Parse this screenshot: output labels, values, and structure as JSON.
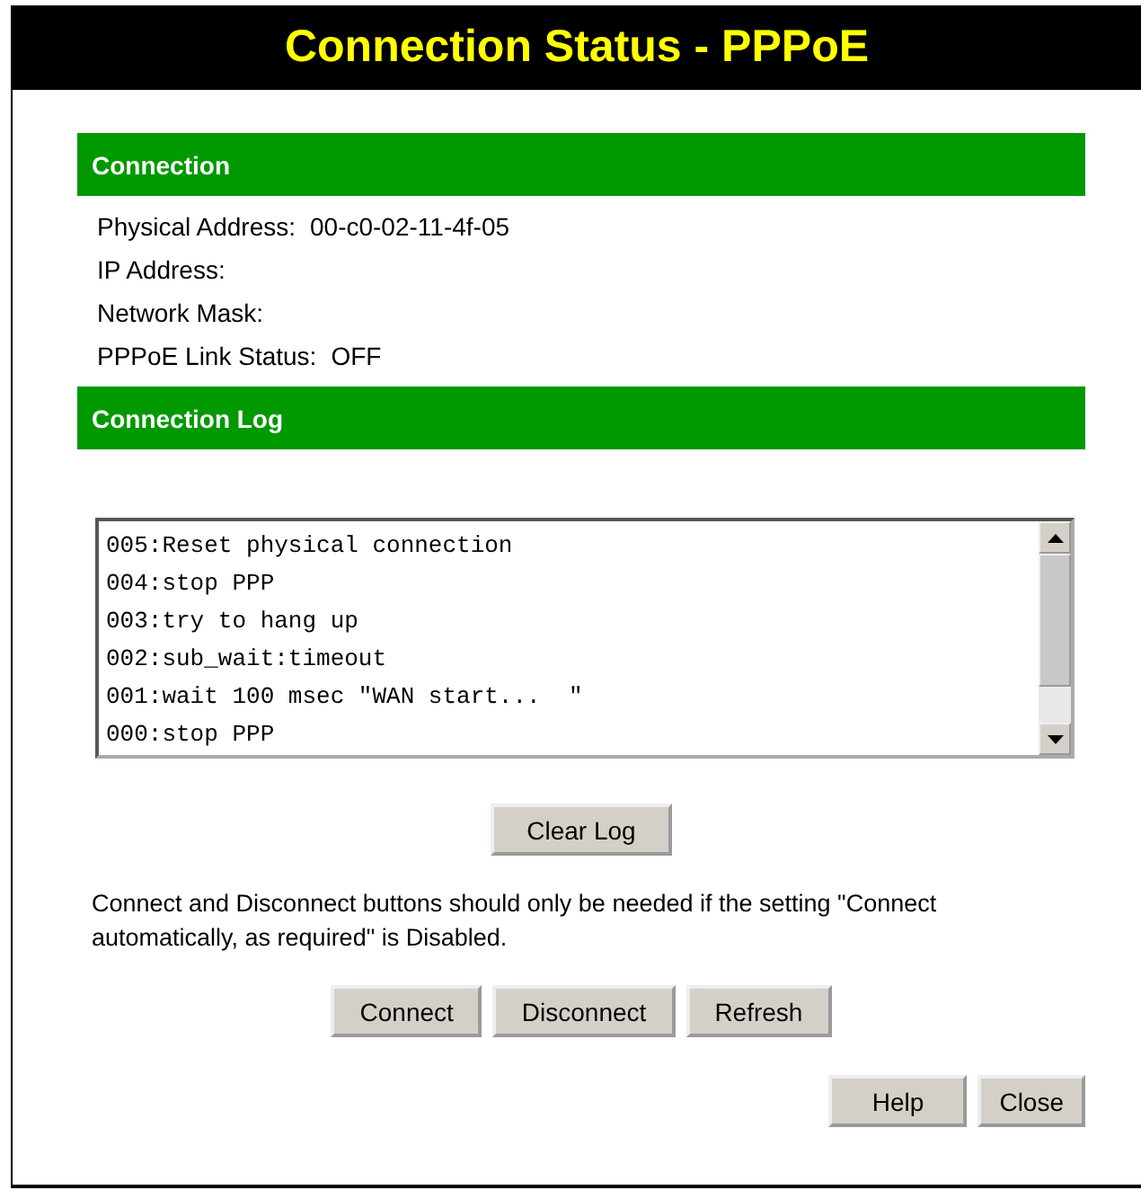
{
  "title": "Connection Status - PPPoE",
  "connection": {
    "heading": "Connection",
    "fields": [
      {
        "label": "Physical Address:",
        "value": "00-c0-02-11-4f-05"
      },
      {
        "label": "IP Address:"
      },
      {
        "label": "Network Mask:"
      },
      {
        "label": "PPPoE Link Status:",
        "value": "OFF"
      }
    ]
  },
  "log": {
    "heading": "Connection Log",
    "lines": [
      "005:Reset physical connection",
      "004:stop PPP",
      "003:try to hang up",
      "002:sub_wait:timeout",
      "001:wait 100 msec \"WAN start...  \"",
      "000:stop PPP"
    ],
    "clear_button": "Clear Log"
  },
  "note": "Connect and Disconnect buttons should only be needed if the setting \"Connect automatically, as required\" is Disabled.",
  "action_buttons": [
    "Connect",
    "Disconnect",
    "Refresh"
  ],
  "footer_buttons": [
    "Help",
    "Close"
  ]
}
